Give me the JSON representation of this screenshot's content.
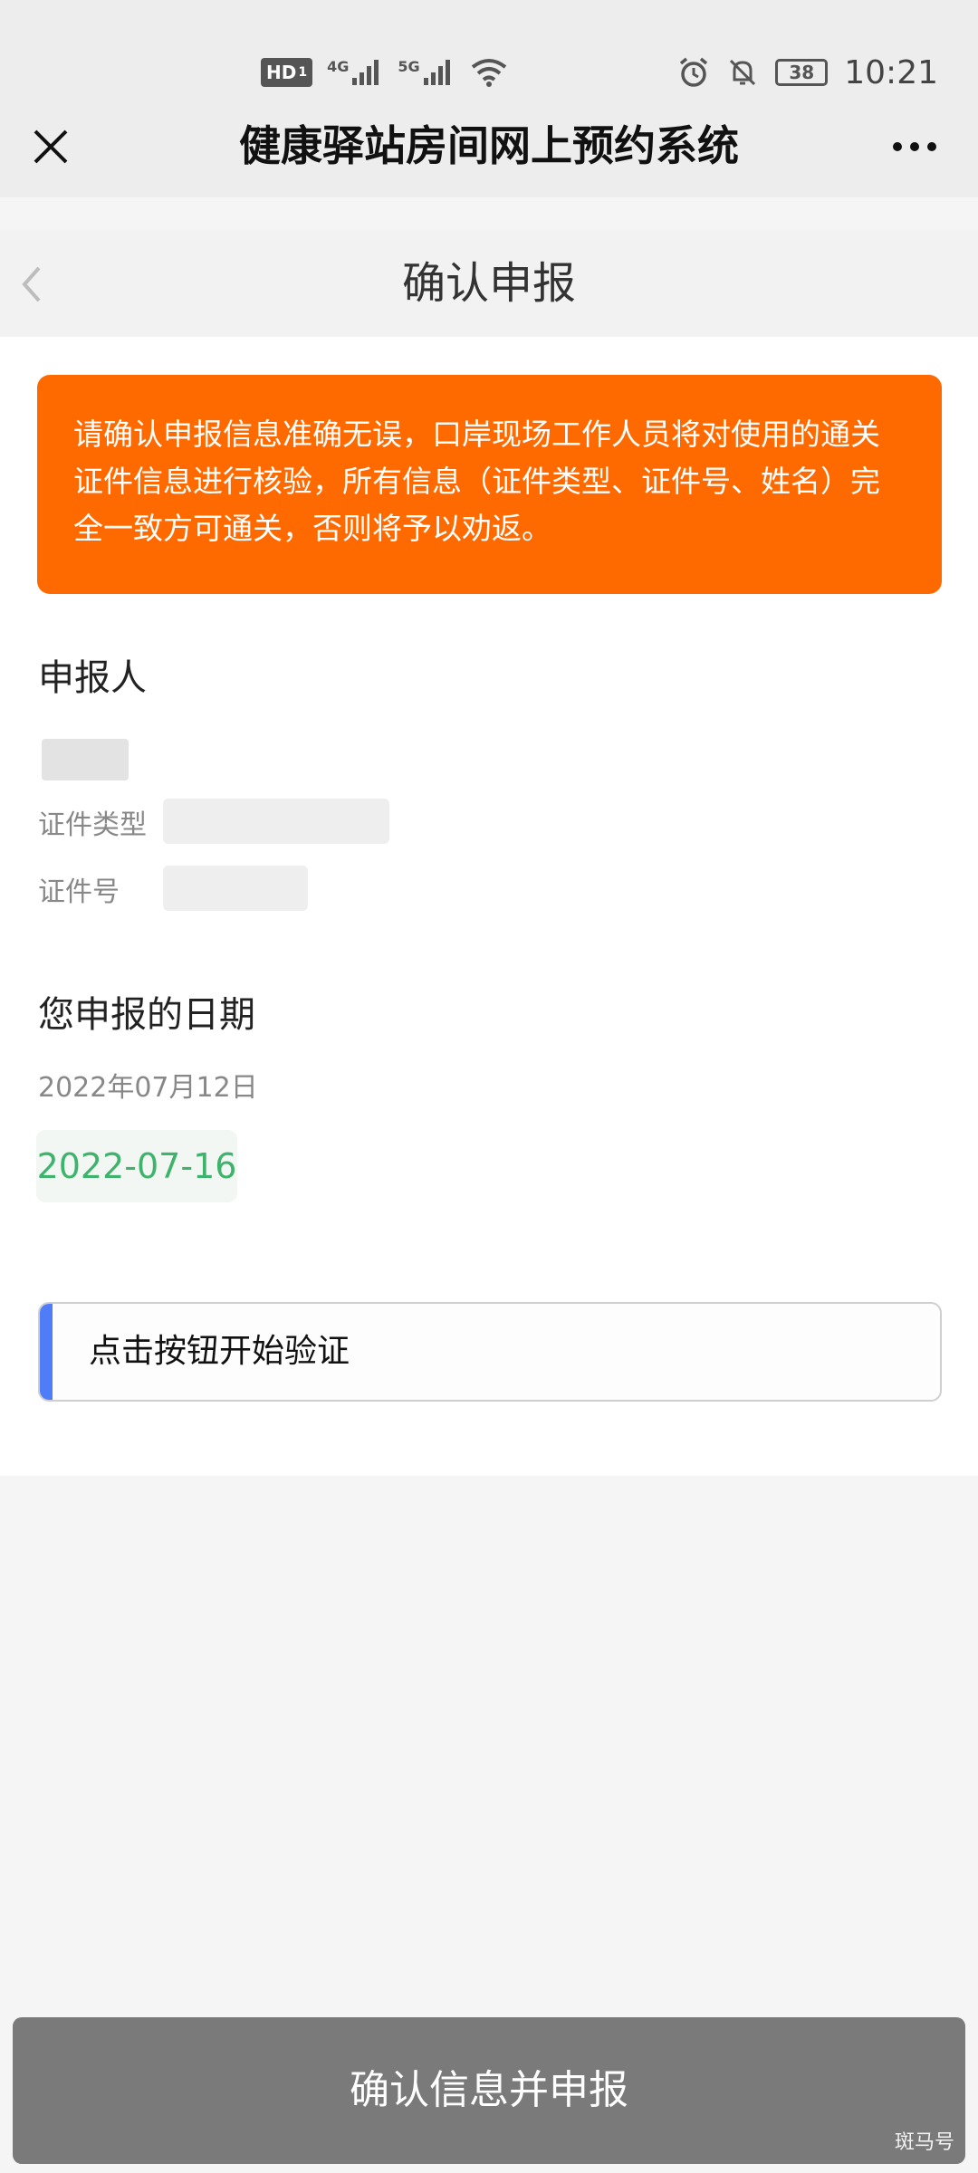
{
  "status_bar": {
    "hd_label": "HD",
    "hd_sim": "1",
    "net_4g": "4G",
    "net_5g": "5G",
    "battery": "38",
    "time": "10:21"
  },
  "titlebar": {
    "title": "健康驿站房间网上预约系统"
  },
  "page": {
    "title": "确认申报"
  },
  "warning": {
    "text": "请确认申报信息准确无误，口岸现场工作人员将对使用的通关证件信息进行核验，所有信息（证件类型、证件号、姓名）完全一致方可通关，否则将予以劝返。"
  },
  "applicant": {
    "title": "申报人",
    "id_type_label": "证件类型",
    "id_number_label": "证件号"
  },
  "dates": {
    "title": "您申报的日期",
    "declared_date": "2022年07月12日",
    "selected_date": "2022-07-16"
  },
  "verify": {
    "label": "点击按钮开始验证"
  },
  "submit": {
    "label": "确认信息并申报"
  },
  "watermark": "斑马号",
  "colors": {
    "warning_bg": "#ff6a00",
    "accent": "#4e7df7",
    "date_green": "#3db36b",
    "submit_bg": "#7a7a7a"
  }
}
